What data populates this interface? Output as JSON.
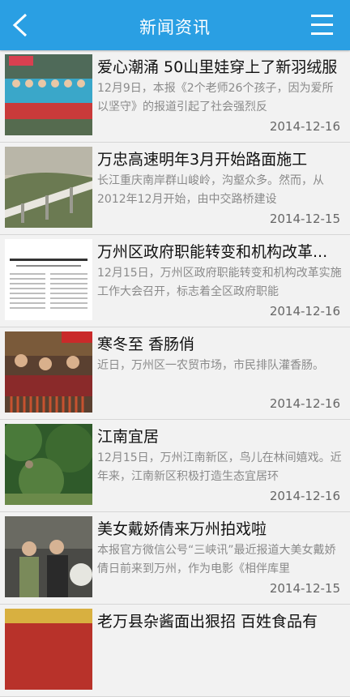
{
  "header": {
    "title": "新闻资讯",
    "back_icon": "chevron-left-icon",
    "menu_icon": "hamburger-menu-icon"
  },
  "news": [
    {
      "title": "爱心潮涌 50山里娃穿上了新羽绒服",
      "summary": "12月9日，本报《2个老师26个孩子，因为爱所以坚守》的报道引起了社会强烈反",
      "date": "2014-12-16"
    },
    {
      "title": "万忠高速明年3月开始路面施工",
      "summary": "长江重庆南岸群山峻岭，沟壑众多。然而，从2012年12月开始，由中交路桥建设",
      "date": "2014-12-15"
    },
    {
      "title": "万州区政府职能转变和机构改革...",
      "summary": "12月15日，万州区政府职能转变和机构改革实施工作大会召开，标志着全区政府职能",
      "date": "2014-12-16"
    },
    {
      "title": "寒冬至 香肠俏",
      "summary": "近日，万州区一农贸市场，市民排队灌香肠。",
      "date": "2014-12-16"
    },
    {
      "title": "江南宜居",
      "summary": "12月15日，万州江南新区，鸟儿在林间嬉戏。近年来，江南新区积极打造生态宜居环",
      "date": "2014-12-16"
    },
    {
      "title": "美女戴娇倩来万州拍戏啦",
      "summary": "本报官方微信公号“三峡讯”最近报道大美女戴娇倩日前来到万州，作为电影《相伴库里",
      "date": "2014-12-15"
    },
    {
      "title": "老万县杂酱面出狠招 百姓食品有",
      "summary": "",
      "date": ""
    }
  ]
}
